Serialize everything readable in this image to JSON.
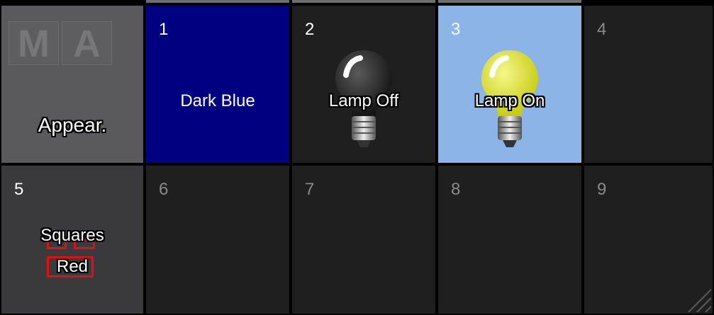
{
  "app_label": "Appear.",
  "logo": [
    "M",
    "A"
  ],
  "cells": [
    {
      "num": "1",
      "label": "Dark  Blue"
    },
    {
      "num": "2",
      "label": "Lamp  Off",
      "icon": "lamp-off-icon"
    },
    {
      "num": "3",
      "label": "Lamp  On",
      "icon": "lamp-on-icon"
    },
    {
      "num": "4",
      "label": ""
    },
    {
      "num": "5",
      "label_line1": "Squares",
      "label_line2": "Red"
    },
    {
      "num": "6",
      "label": ""
    },
    {
      "num": "7",
      "label": ""
    },
    {
      "num": "8",
      "label": ""
    },
    {
      "num": "9",
      "label": ""
    }
  ],
  "colors": {
    "dark_blue": "#000080",
    "lamp_on_bg": "#8cb4e6",
    "header_bg": "#5a5a5c",
    "empty_cell": "#1f1f1f",
    "squares_red": "#e01010"
  }
}
